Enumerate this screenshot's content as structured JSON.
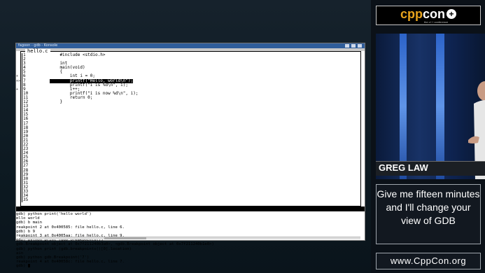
{
  "window": {
    "title": "fagoon - gdb - Konsole",
    "source_tab": "hello.c",
    "source_lines": [
      {
        "num": "1",
        "code": "    #include <stdio.h>",
        "marker": "",
        "highlight": false
      },
      {
        "num": "2",
        "code": "",
        "marker": "",
        "highlight": false
      },
      {
        "num": "3",
        "code": "    int",
        "marker": "",
        "highlight": false
      },
      {
        "num": "4",
        "code": "    main(void)",
        "marker": "",
        "highlight": false
      },
      {
        "num": "5",
        "code": "    {",
        "marker": "",
        "highlight": false
      },
      {
        "num": "6",
        "code": "        int i = 0;",
        "marker": "+",
        "highlight": false
      },
      {
        "num": "7",
        "code": "        printf(\"Hello, world\\n\");",
        "marker": "+>",
        "highlight": true
      },
      {
        "num": "8",
        "code": "        printf(\"i is %d\\n\", i);",
        "marker": "",
        "highlight": false
      },
      {
        "num": "9",
        "code": "        i++;",
        "marker": "+",
        "highlight": false
      },
      {
        "num": "10",
        "code": "        printf(\"i is now %d\\n\", i);",
        "marker": "",
        "highlight": false
      },
      {
        "num": "11",
        "code": "        return 0;",
        "marker": "",
        "highlight": false
      },
      {
        "num": "12",
        "code": "    }",
        "marker": "",
        "highlight": false
      },
      {
        "num": "13",
        "code": "",
        "marker": "",
        "highlight": false
      },
      {
        "num": "14",
        "code": "",
        "marker": "",
        "highlight": false
      },
      {
        "num": "15",
        "code": "",
        "marker": "",
        "highlight": false
      },
      {
        "num": "16",
        "code": "",
        "marker": "",
        "highlight": false
      },
      {
        "num": "17",
        "code": "",
        "marker": "",
        "highlight": false
      },
      {
        "num": "18",
        "code": "",
        "marker": "",
        "highlight": false
      },
      {
        "num": "19",
        "code": "",
        "marker": "",
        "highlight": false
      },
      {
        "num": "20",
        "code": "",
        "marker": "",
        "highlight": false
      },
      {
        "num": "21",
        "code": "",
        "marker": "",
        "highlight": false
      },
      {
        "num": "22",
        "code": "",
        "marker": "",
        "highlight": false
      },
      {
        "num": "23",
        "code": "",
        "marker": "",
        "highlight": false
      },
      {
        "num": "24",
        "code": "",
        "marker": "",
        "highlight": false
      },
      {
        "num": "25",
        "code": "",
        "marker": "",
        "highlight": false
      },
      {
        "num": "26",
        "code": "",
        "marker": "",
        "highlight": false
      },
      {
        "num": "27",
        "code": "",
        "marker": "",
        "highlight": false
      },
      {
        "num": "28",
        "code": "",
        "marker": "",
        "highlight": false
      },
      {
        "num": "29",
        "code": "",
        "marker": "",
        "highlight": false
      },
      {
        "num": "30",
        "code": "",
        "marker": "",
        "highlight": false
      },
      {
        "num": "31",
        "code": "",
        "marker": "",
        "highlight": false
      },
      {
        "num": "32",
        "code": "",
        "marker": "",
        "highlight": false
      },
      {
        "num": "33",
        "code": "",
        "marker": "",
        "highlight": false
      },
      {
        "num": "34",
        "code": "",
        "marker": "",
        "highlight": false
      },
      {
        "num": "35",
        "code": "",
        "marker": "",
        "highlight": false
      }
    ],
    "status_left": "ild process 7418 In: main",
    "status_right": "Line: 7    PC: 0x40058c",
    "console_lines": [
      "gdb) python print('hello world')",
      "ello world",
      "gdb) b main",
      "reakpoint 2 at 0x400585: file hello.c, line 6.",
      "gdb) b 9",
      "reakpoint 3 at 0x4005aa: file hello.c, line 9.",
      "gdb) python print (gdb.breakpoints())",
      "gdb.Breakpoint object at 0x7f211240b3a0>, <gdb.Breakpoint object at 0x7f211240b1e0>)",
      "gdb) python print (gdb.breakpoints()[0].location)",
      "ain",
      "gdb) python gdb.Breakpoint('7')",
      "reakpoint 4 at 0x40058c: file hello.c, line 7.",
      "gdb) "
    ]
  },
  "brand": {
    "cpp": "cpp",
    "con": "con",
    "tagline": "the c++ conference"
  },
  "speaker_name": "GREG LAW",
  "quote": "Give me fifteen minutes and I'll change your view of GDB",
  "website": "www.CppCon.org"
}
